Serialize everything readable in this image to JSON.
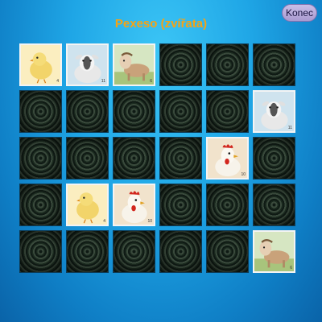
{
  "title": "Pexeso (zvířata)",
  "quit_label": "Konec",
  "colors": {
    "title": "#f6a314",
    "card_back": "#2c3a2e"
  },
  "cards": [
    {
      "state": "face",
      "animal": "chick",
      "number": "4"
    },
    {
      "state": "face",
      "animal": "goat",
      "number": "11"
    },
    {
      "state": "face",
      "animal": "horse",
      "number": "6"
    },
    {
      "state": "back"
    },
    {
      "state": "back"
    },
    {
      "state": "back"
    },
    {
      "state": "back"
    },
    {
      "state": "back"
    },
    {
      "state": "back"
    },
    {
      "state": "back"
    },
    {
      "state": "back"
    },
    {
      "state": "face",
      "animal": "goat",
      "number": "11"
    },
    {
      "state": "back"
    },
    {
      "state": "back"
    },
    {
      "state": "back"
    },
    {
      "state": "back"
    },
    {
      "state": "face",
      "animal": "rooster",
      "number": "10"
    },
    {
      "state": "back"
    },
    {
      "state": "back"
    },
    {
      "state": "face",
      "animal": "chick",
      "number": "4"
    },
    {
      "state": "face",
      "animal": "rooster",
      "number": "10"
    },
    {
      "state": "back"
    },
    {
      "state": "back"
    },
    {
      "state": "back"
    },
    {
      "state": "back"
    },
    {
      "state": "back"
    },
    {
      "state": "back"
    },
    {
      "state": "back"
    },
    {
      "state": "back"
    },
    {
      "state": "face",
      "animal": "horse",
      "number": "6"
    }
  ]
}
